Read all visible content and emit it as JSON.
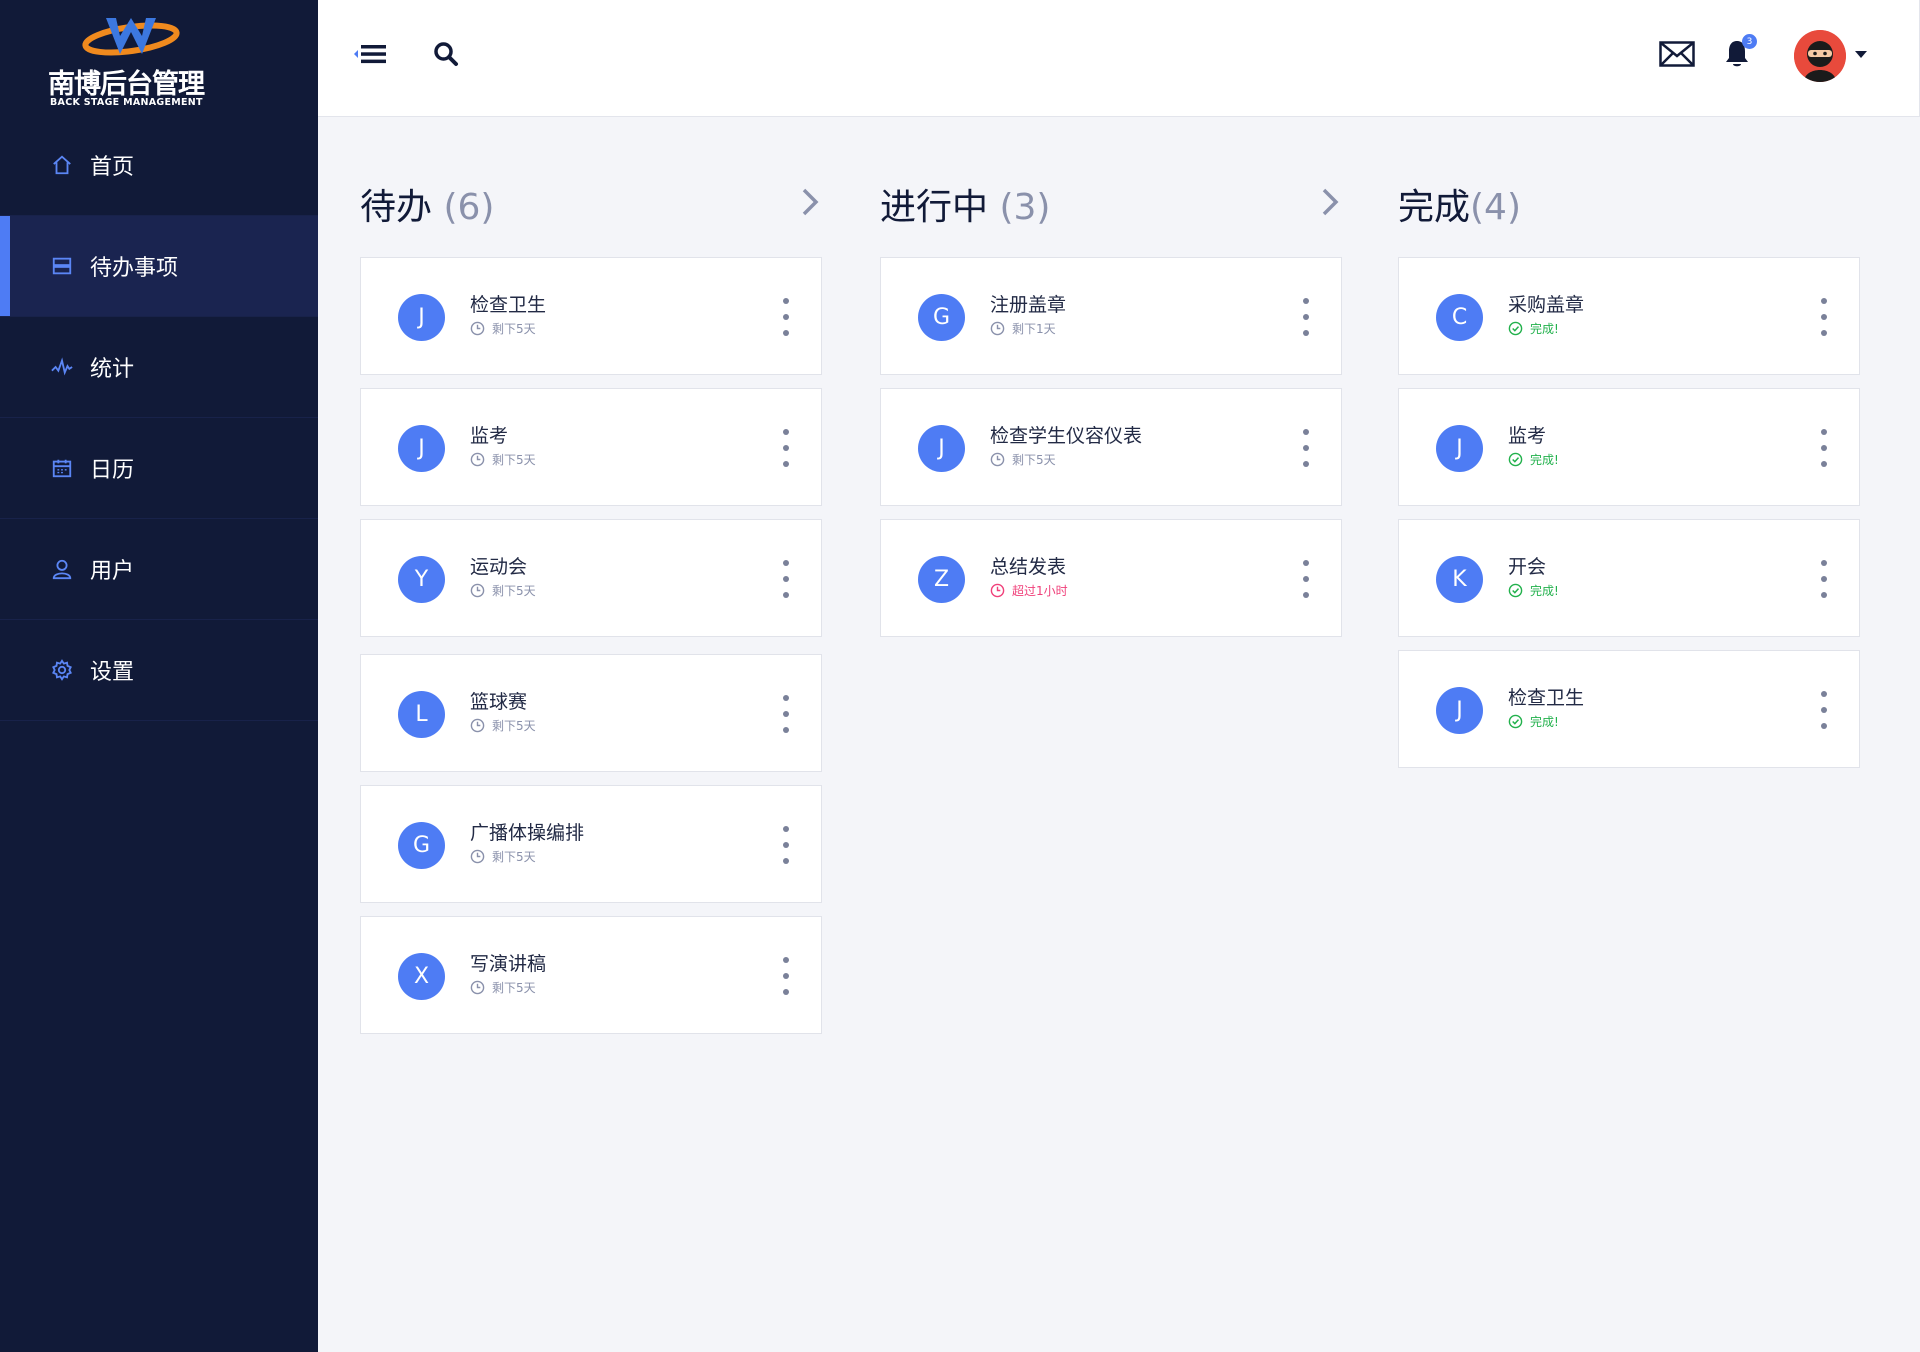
{
  "app": {
    "logo_title": "南博后台管理",
    "logo_subtitle": "BACK STAGE MANAGEMENT"
  },
  "sidebar": {
    "items": [
      {
        "label": "首页",
        "icon": "home-icon"
      },
      {
        "label": "待办事项",
        "icon": "list-icon",
        "active": true
      },
      {
        "label": "统计",
        "icon": "activity-icon"
      },
      {
        "label": "日历",
        "icon": "calendar-icon"
      },
      {
        "label": "用户",
        "icon": "user-icon"
      },
      {
        "label": "设置",
        "icon": "gear-icon"
      }
    ]
  },
  "header": {
    "notification_count": "3"
  },
  "columns": [
    {
      "title": "待办",
      "count": "(6)",
      "cards": [
        {
          "initial": "J",
          "title": "检查卫生",
          "status": "剩下5天",
          "status_type": "pending"
        },
        {
          "initial": "J",
          "title": "监考",
          "status": "剩下5天",
          "status_type": "pending"
        },
        {
          "initial": "Y",
          "title": "运动会",
          "status": "剩下5天",
          "status_type": "pending"
        },
        {
          "initial": "L",
          "title": "篮球赛",
          "status": "剩下5天",
          "status_type": "pending"
        },
        {
          "initial": "G",
          "title": "广播体操编排",
          "status": "剩下5天",
          "status_type": "pending"
        },
        {
          "initial": "X",
          "title": "写演讲稿",
          "status": "剩下5天",
          "status_type": "pending"
        }
      ]
    },
    {
      "title": "进行中",
      "count": "(3)",
      "cards": [
        {
          "initial": "G",
          "title": "注册盖章",
          "status": "剩下1天",
          "status_type": "pending"
        },
        {
          "initial": "J",
          "title": "检查学生仪容仪表",
          "status": "剩下5天",
          "status_type": "pending"
        },
        {
          "initial": "Z",
          "title": "总结发表",
          "status": "超过1小时",
          "status_type": "overdue"
        }
      ]
    },
    {
      "title": "完成",
      "count": "(4)",
      "cards": [
        {
          "initial": "C",
          "title": "采购盖章",
          "status": "完成!",
          "status_type": "done"
        },
        {
          "initial": "J",
          "title": "监考",
          "status": "完成!",
          "status_type": "done"
        },
        {
          "initial": "K",
          "title": "开会",
          "status": "完成!",
          "status_type": "done"
        },
        {
          "initial": "J",
          "title": "检查卫生",
          "status": "完成!",
          "status_type": "done"
        }
      ]
    }
  ],
  "colors": {
    "accent": "#4e7cf4",
    "sidebar_bg": "#111a38",
    "overdue": "#f0407a",
    "done": "#22b14c",
    "muted": "#8a91ab"
  }
}
